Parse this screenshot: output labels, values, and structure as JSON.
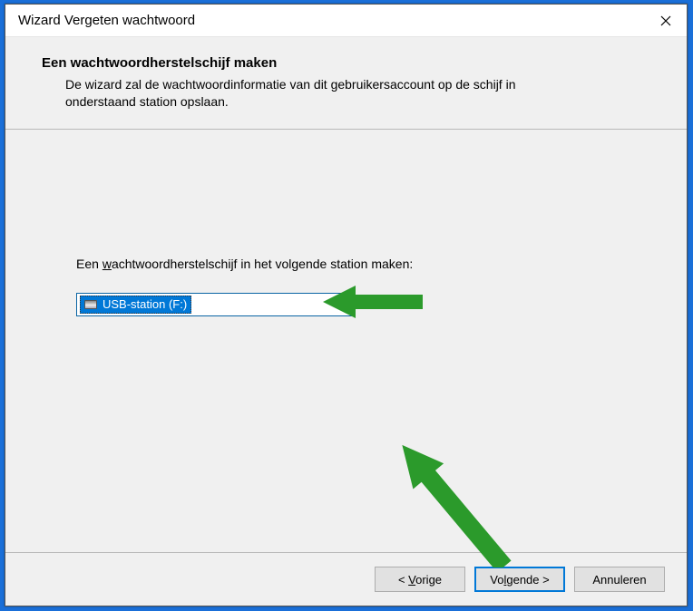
{
  "window": {
    "title": "Wizard Vergeten wachtwoord"
  },
  "header": {
    "heading": "Een wachtwoordherstelschijf maken",
    "description": "De wizard zal de wachtwoordinformatie van dit gebruikersaccount op de schijf in onderstaand station opslaan."
  },
  "content": {
    "label_prefix": "Een ",
    "label_mnemonic": "w",
    "label_rest": "achtwoordherstelschijf in het volgende station maken:",
    "drive_selected": "USB-station (F:)"
  },
  "footer": {
    "back_prefix": "< ",
    "back_mnemonic": "V",
    "back_rest": "orige",
    "next_prefix": "Vo",
    "next_mnemonic": "l",
    "next_rest": "gende >",
    "cancel_label": "Annuleren"
  }
}
